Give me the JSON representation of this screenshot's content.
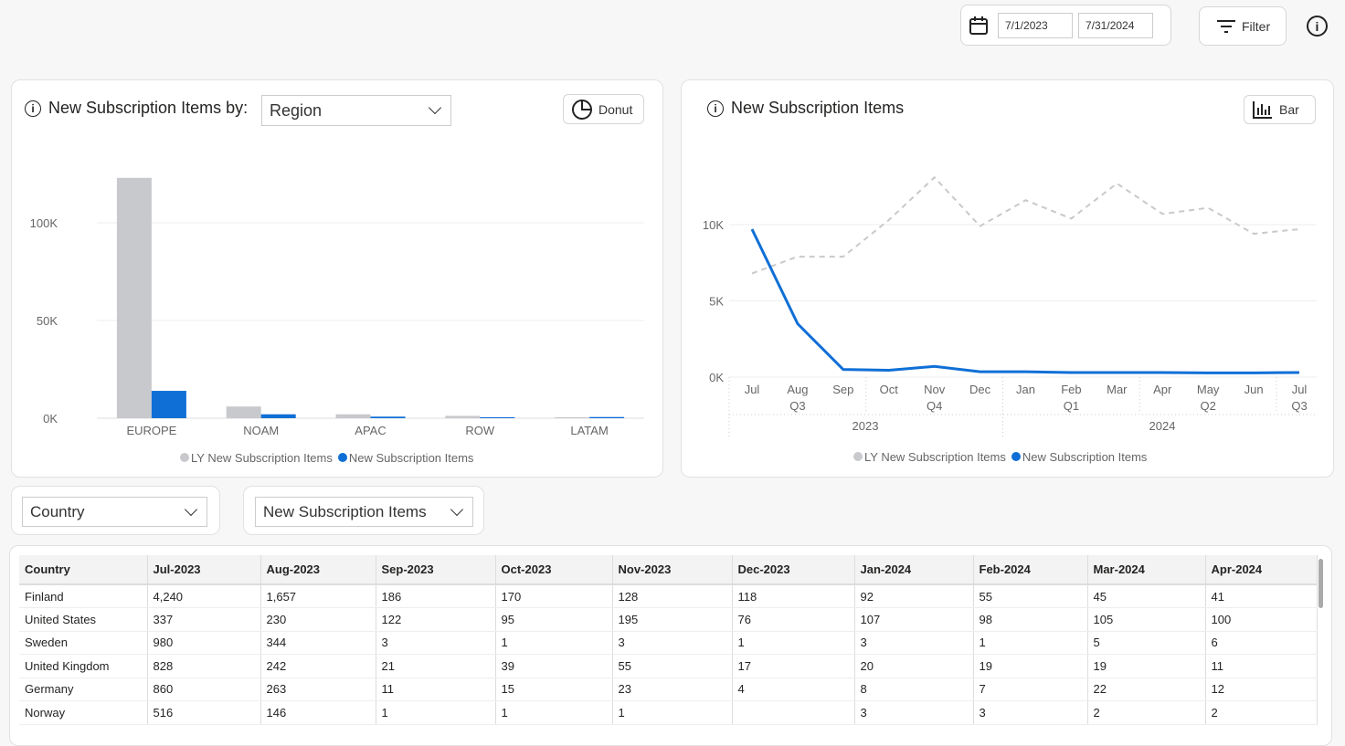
{
  "header": {
    "date_start": "7/1/2023",
    "date_end": "7/31/2024",
    "filter_label": "Filter",
    "icons": [
      "calendar-icon",
      "filter-icon",
      "info-icon"
    ]
  },
  "region_panel": {
    "title": "New Subscription Items by:",
    "dropdown_value": "Region",
    "toggle_label": "Donut"
  },
  "trend_panel": {
    "title": "New Subscription Items",
    "toggle_label": "Bar"
  },
  "colors": {
    "ly": "#c8c9cc",
    "current": "#0f6fd6"
  },
  "chart_data": [
    {
      "type": "bar",
      "categories": [
        "EUROPE",
        "NOAM",
        "APAC",
        "ROW",
        "LATAM"
      ],
      "series": [
        {
          "name": "LY New Subscription Items",
          "values": [
            123000,
            6000,
            2000,
            1200,
            500
          ]
        },
        {
          "name": "New Subscription Items",
          "values": [
            14000,
            2000,
            800,
            500,
            600
          ]
        }
      ],
      "yticks": [
        "0K",
        "50K",
        "100K"
      ],
      "ylim": [
        0,
        130000
      ],
      "grid": true,
      "legend": "bottom"
    },
    {
      "type": "line",
      "categories": [
        "Jul",
        "Aug",
        "Sep",
        "Oct",
        "Nov",
        "Dec",
        "Jan",
        "Feb",
        "Mar",
        "Apr",
        "May",
        "Jun",
        "Jul"
      ],
      "quarters": [
        {
          "label": "Q3",
          "at": 1
        },
        {
          "label": "Q4",
          "at": 4
        },
        {
          "label": "Q1",
          "at": 7
        },
        {
          "label": "Q2",
          "at": 10
        },
        {
          "label": "Q3",
          "at": 12
        }
      ],
      "years": [
        "2023",
        "2024"
      ],
      "series": [
        {
          "name": "LY New Subscription Items",
          "style": "dashed",
          "values": [
            6800,
            7900,
            7900,
            10300,
            13100,
            9900,
            11600,
            10400,
            12700,
            10700,
            11100,
            9400,
            9700
          ]
        },
        {
          "name": "New Subscription Items",
          "values": [
            9700,
            3500,
            500,
            450,
            700,
            350,
            350,
            300,
            300,
            300,
            280,
            280,
            300
          ]
        }
      ],
      "yticks": [
        "0K",
        "5K",
        "10K"
      ],
      "ylim": [
        0,
        14000
      ],
      "grid": true,
      "legend": "bottom"
    }
  ],
  "selectors": {
    "dimension": "Country",
    "measure": "New Subscription Items"
  },
  "table": {
    "columns": [
      "Country",
      "Jul-2023",
      "Aug-2023",
      "Sep-2023",
      "Oct-2023",
      "Nov-2023",
      "Dec-2023",
      "Jan-2024",
      "Feb-2024",
      "Mar-2024",
      "Apr-2024"
    ],
    "rows": [
      [
        "Finland",
        "4,240",
        "1,657",
        "186",
        "170",
        "128",
        "118",
        "92",
        "55",
        "45",
        "41"
      ],
      [
        "United States",
        "337",
        "230",
        "122",
        "95",
        "195",
        "76",
        "107",
        "98",
        "105",
        "100"
      ],
      [
        "Sweden",
        "980",
        "344",
        "3",
        "1",
        "3",
        "1",
        "3",
        "1",
        "5",
        "6"
      ],
      [
        "United Kingdom",
        "828",
        "242",
        "21",
        "39",
        "55",
        "17",
        "20",
        "19",
        "19",
        "11"
      ],
      [
        "Germany",
        "860",
        "263",
        "11",
        "15",
        "23",
        "4",
        "8",
        "7",
        "22",
        "12"
      ],
      [
        "Norway",
        "516",
        "146",
        "1",
        "1",
        "1",
        "",
        "3",
        "3",
        "2",
        "2"
      ]
    ]
  }
}
